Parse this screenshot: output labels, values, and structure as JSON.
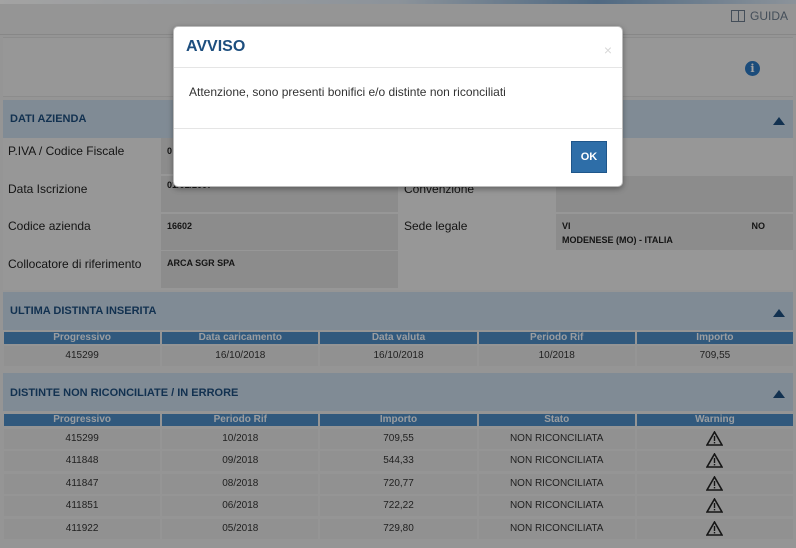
{
  "header": {
    "guida_label": "GUIDA"
  },
  "dati_azienda": {
    "title": "DATI AZIENDA",
    "piva_label": "P.IVA / Codice Fiscale",
    "piva_value": "0",
    "data_iscrizione_label": "Data Iscrizione",
    "data_iscrizione_value": "01/01/2007",
    "codice_azienda_label": "Codice azienda",
    "codice_azienda_value": "16602",
    "collocatore_label": "Collocatore di riferimento",
    "collocatore_value": "ARCA SGR SPA",
    "convenzione_label": "Convenzione",
    "convenzione_value": "-",
    "sede_legale_label": "Sede legale",
    "sede_legale_line1": "VI",
    "sede_legale_line1_end": "NO",
    "sede_legale_line2": "MODENESE (MO) - ITALIA"
  },
  "ultima_distinta": {
    "title": "ULTIMA DISTINTA INSERITA",
    "columns": [
      "Progressivo",
      "Data caricamento",
      "Data valuta",
      "Periodo Rif",
      "Importo"
    ],
    "rows": [
      [
        "415299",
        "16/10/2018",
        "16/10/2018",
        "10/2018",
        "709,55"
      ]
    ]
  },
  "distinte_non_riconciliate": {
    "title": "DISTINTE NON RICONCILIATE / IN ERRORE",
    "columns": [
      "Progressivo",
      "Periodo Rif",
      "Importo",
      "Stato",
      "Warning"
    ],
    "rows": [
      [
        "415299",
        "10/2018",
        "709,55",
        "NON RICONCILIATA"
      ],
      [
        "411848",
        "09/2018",
        "544,33",
        "NON RICONCILIATA"
      ],
      [
        "411847",
        "08/2018",
        "720,77",
        "NON RICONCILIATA"
      ],
      [
        "411851",
        "06/2018",
        "722,22",
        "NON RICONCILIATA"
      ],
      [
        "411922",
        "05/2018",
        "729,80",
        "NON RICONCILIATA"
      ]
    ],
    "warning_icon": "warning-triangle-icon"
  },
  "modal": {
    "title": "AVVISO",
    "close_glyph": "×",
    "message": "Attenzione, sono presenti bonifici e/o distinte non riconciliati",
    "ok_label": "OK"
  },
  "colors": {
    "accent": "#1d4e7e",
    "header_bg": "#c9daea",
    "table_header": "#4e8cc4",
    "ok_button": "#2e6ea8"
  }
}
